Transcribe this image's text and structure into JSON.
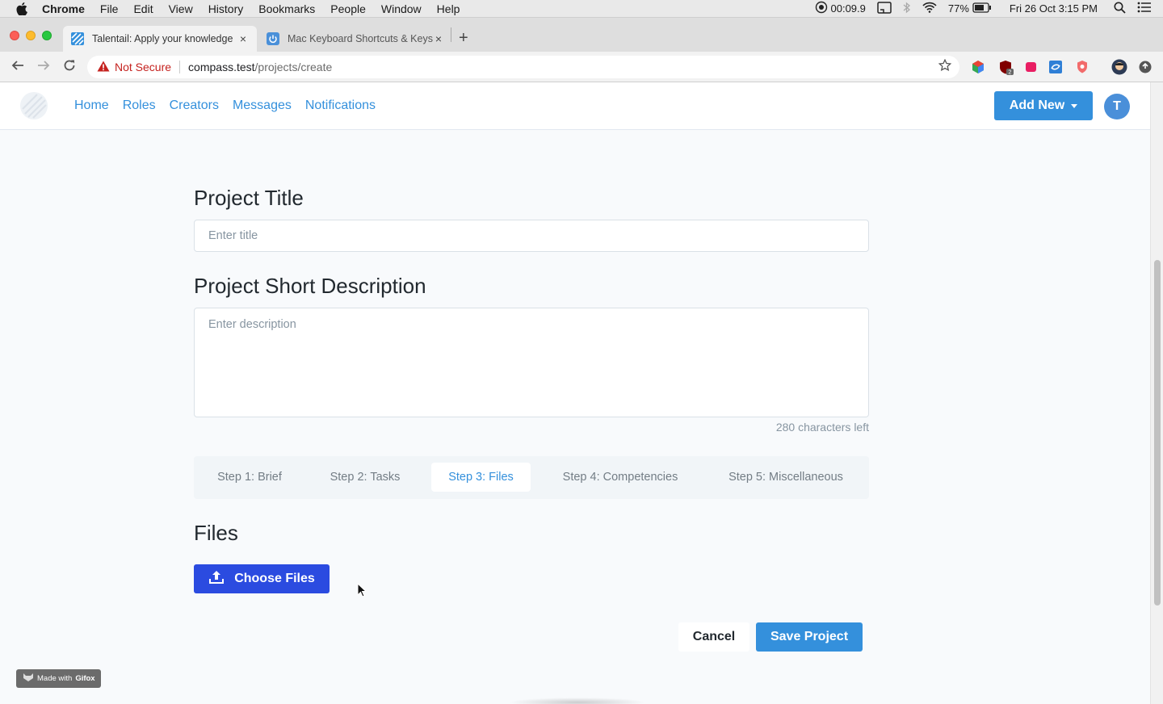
{
  "menubar": {
    "app": "Chrome",
    "items": [
      "File",
      "Edit",
      "View",
      "History",
      "Bookmarks",
      "People",
      "Window",
      "Help"
    ],
    "timer": "00:09.9",
    "battery": "77%",
    "datetime": "Fri 26 Oct  3:15 PM"
  },
  "tabs": [
    {
      "title": "Talentail: Apply your knowledge",
      "close": "×"
    },
    {
      "title": "Mac Keyboard Shortcuts & Keys",
      "close": "×"
    }
  ],
  "newtab": "+",
  "addressbar": {
    "security": "Not Secure",
    "host": "compass.test",
    "path": "/projects/create"
  },
  "nav": {
    "links": [
      "Home",
      "Roles",
      "Creators",
      "Messages",
      "Notifications"
    ],
    "add_new": "Add New",
    "avatar_initial": "T"
  },
  "form": {
    "title_heading": "Project Title",
    "title_placeholder": "Enter title",
    "desc_heading": "Project Short Description",
    "desc_placeholder": "Enter description",
    "chars_left": "280 characters left",
    "steps": [
      "Step 1: Brief",
      "Step 2: Tasks",
      "Step 3: Files",
      "Step 4: Competencies",
      "Step 5: Miscellaneous"
    ],
    "active_step": 2,
    "files_heading": "Files",
    "choose_files": "Choose Files",
    "cancel": "Cancel",
    "save": "Save Project"
  },
  "watermark": {
    "prefix": "Made with",
    "brand": "Gifox"
  },
  "colors": {
    "primary": "#3490dc",
    "choose_files": "#2b4be0",
    "not_secure": "#c5221f"
  },
  "icons": [
    "apple-icon",
    "record-icon",
    "cast-icon",
    "bluetooth-icon",
    "wifi-icon",
    "battery-icon",
    "spotlight-icon",
    "notification-center-icon",
    "upload-icon",
    "star-icon",
    "warning-icon"
  ]
}
